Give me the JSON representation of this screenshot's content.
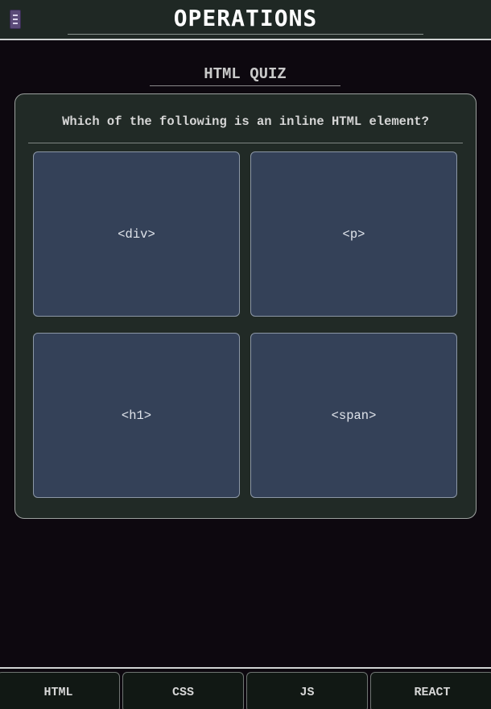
{
  "header": {
    "title": "OPERATIONS",
    "menu_icon": "menu-icon"
  },
  "section": {
    "title": "HTML QUIZ"
  },
  "quiz": {
    "question": "Which of the following is an inline HTML element?",
    "options": [
      "<div>",
      "<p>",
      "<h1>",
      "<span>"
    ]
  },
  "tabs": [
    "HTML",
    "CSS",
    "JS",
    "REACT"
  ],
  "colors": {
    "background": "#0d080f",
    "header_bg": "#1f2824",
    "card_bg": "#212a26",
    "option_bg": "#344158",
    "tab_bg": "#111814"
  }
}
